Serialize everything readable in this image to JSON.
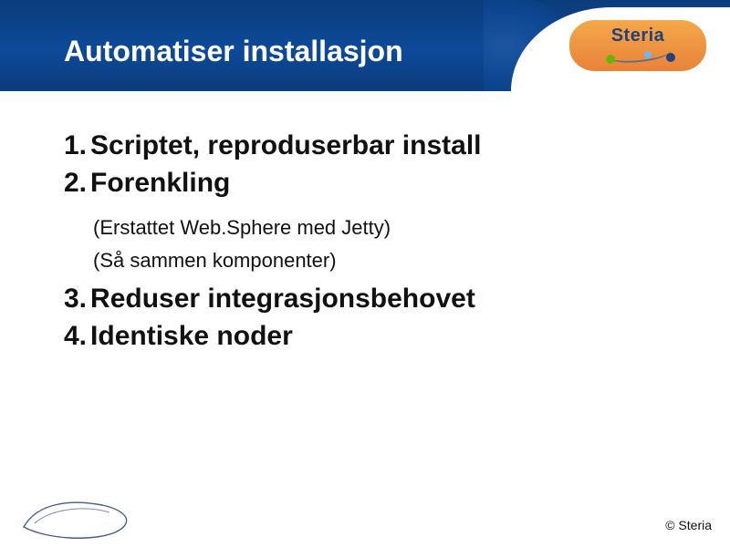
{
  "header": {
    "title": "Automatiser installasjon"
  },
  "logo": {
    "name": "Steria"
  },
  "items": [
    {
      "num": "1.",
      "text": "Scriptet, reproduserbar install"
    },
    {
      "num": "2.",
      "text": "Forenkling"
    }
  ],
  "sub_items": [
    "(Erstattet Web.Sphere med Jetty)",
    "(Så sammen komponenter)"
  ],
  "items2": [
    {
      "num": "3.",
      "text": "Reduser integrasjonsbehovet"
    },
    {
      "num": "4.",
      "text": "Identiske noder"
    }
  ],
  "footer": {
    "copyright": "© Steria"
  }
}
